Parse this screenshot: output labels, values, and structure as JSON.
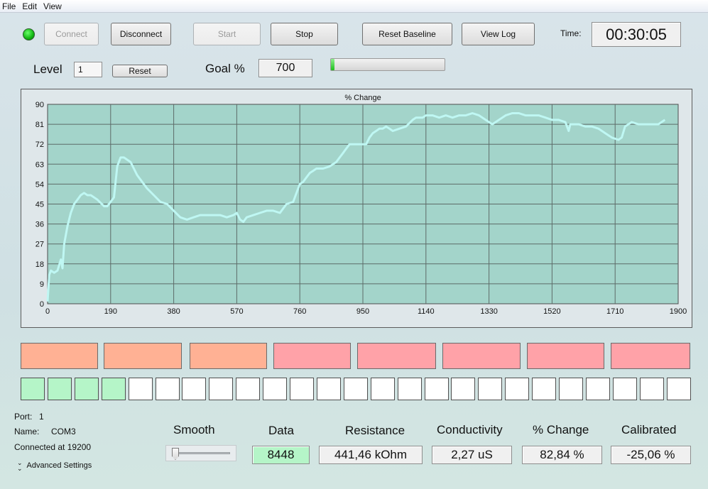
{
  "menu": [
    "File",
    "Edit",
    "View"
  ],
  "toolbar": {
    "connect": "Connect",
    "disconnect": "Disconnect",
    "start": "Start",
    "stop": "Stop",
    "reset_baseline": "Reset Baseline",
    "view_log": "View Log",
    "time_label": "Time:",
    "time_value": "00:30:05"
  },
  "level": {
    "label": "Level",
    "value": "1",
    "reset": "Reset"
  },
  "goal": {
    "label": "Goal %",
    "value": "700",
    "progress_percent": 3
  },
  "chart_data": {
    "type": "line",
    "title": "% Change",
    "xlim": [
      0,
      1900
    ],
    "ylim": [
      0,
      90
    ],
    "xticks": [
      "0",
      "190",
      "380",
      "570",
      "760",
      "950",
      "1140",
      "1330",
      "1520",
      "1710",
      "1900"
    ],
    "yticks": [
      "0",
      "9",
      "18",
      "27",
      "36",
      "45",
      "54",
      "63",
      "72",
      "81",
      "90"
    ],
    "grid": true,
    "line_color": "#bff7f3",
    "plot_bg": "#a3d4ca",
    "series": [
      {
        "x": [
          0,
          5,
          10,
          20,
          30,
          40,
          45,
          50,
          60,
          70,
          80,
          90,
          100,
          110,
          120,
          130,
          150,
          170,
          180,
          190,
          200,
          210,
          220,
          230,
          240,
          250,
          260,
          270,
          280,
          300,
          320,
          340,
          360,
          380,
          400,
          420,
          440,
          460,
          480,
          500,
          520,
          540,
          560,
          570,
          580,
          590,
          600,
          620,
          640,
          660,
          680,
          700,
          710,
          720,
          740,
          750,
          760,
          770,
          780,
          790,
          800,
          810,
          830,
          850,
          870,
          880,
          890,
          900,
          910,
          920,
          930,
          950,
          960,
          970,
          980,
          990,
          1000,
          1010,
          1020,
          1030,
          1040,
          1060,
          1080,
          1100,
          1110,
          1120,
          1130,
          1140,
          1160,
          1180,
          1200,
          1220,
          1240,
          1260,
          1280,
          1300,
          1320,
          1340,
          1360,
          1380,
          1400,
          1420,
          1440,
          1460,
          1480,
          1500,
          1520,
          1540,
          1560,
          1570,
          1575,
          1580,
          1600,
          1620,
          1640,
          1660,
          1680,
          1700,
          1720,
          1730,
          1740,
          1760,
          1780,
          1800,
          1820,
          1840,
          1850,
          1860
        ],
        "y": [
          1,
          13,
          15,
          14,
          15,
          20,
          16,
          27,
          35,
          41,
          45,
          47,
          49,
          50,
          49,
          49,
          47,
          44,
          44,
          46,
          48,
          62,
          66,
          66,
          65,
          64,
          61,
          58,
          56,
          52,
          49,
          46,
          45,
          42,
          39,
          38,
          39,
          40,
          40,
          40,
          40,
          39,
          40,
          41,
          38,
          37,
          39,
          40,
          41,
          42,
          42,
          41,
          43,
          45,
          46,
          50,
          54,
          55,
          57,
          59,
          60,
          61,
          61,
          62,
          64,
          66,
          68,
          70,
          72,
          72,
          72,
          72,
          72,
          75,
          77,
          78,
          79,
          79,
          80,
          79,
          78,
          79,
          80,
          83,
          84,
          84,
          84,
          85,
          85,
          84,
          85,
          84,
          85,
          85,
          86,
          85,
          83,
          81,
          83,
          85,
          86,
          86,
          85,
          85,
          85,
          84,
          83,
          83,
          82,
          78,
          81,
          81,
          81,
          80,
          80,
          79,
          77,
          75,
          74,
          75,
          80,
          82,
          81,
          81,
          81,
          81,
          82,
          83
        ]
      }
    ]
  },
  "pads": {
    "row1": [
      "#ffb194",
      "#ffb194",
      "#ffb194",
      "#ffa2a8",
      "#ffa2a8",
      "#ffa2a8",
      "#ffa2a8",
      "#ffa2a8"
    ],
    "row2_on_count": 4,
    "row2_total": 25,
    "on_color": "#b5f5c8"
  },
  "status": {
    "port_label": "Port:",
    "port_value": "1",
    "name_label": "Name:",
    "name_value": "COM3",
    "connected": "Connected at 19200",
    "advanced": "Advanced Settings"
  },
  "readouts": {
    "smooth_label": "Smooth",
    "smooth_value": 0,
    "data_label": "Data",
    "data_value": "8448",
    "resistance_label": "Resistance",
    "resistance_value": "441,46 kOhm",
    "conductivity_label": "Conductivity",
    "conductivity_value": "2,27 uS",
    "pchange_label": "% Change",
    "pchange_value": "82,84 %",
    "calibrated_label": "Calibrated",
    "calibrated_value": "-25,06 %"
  }
}
